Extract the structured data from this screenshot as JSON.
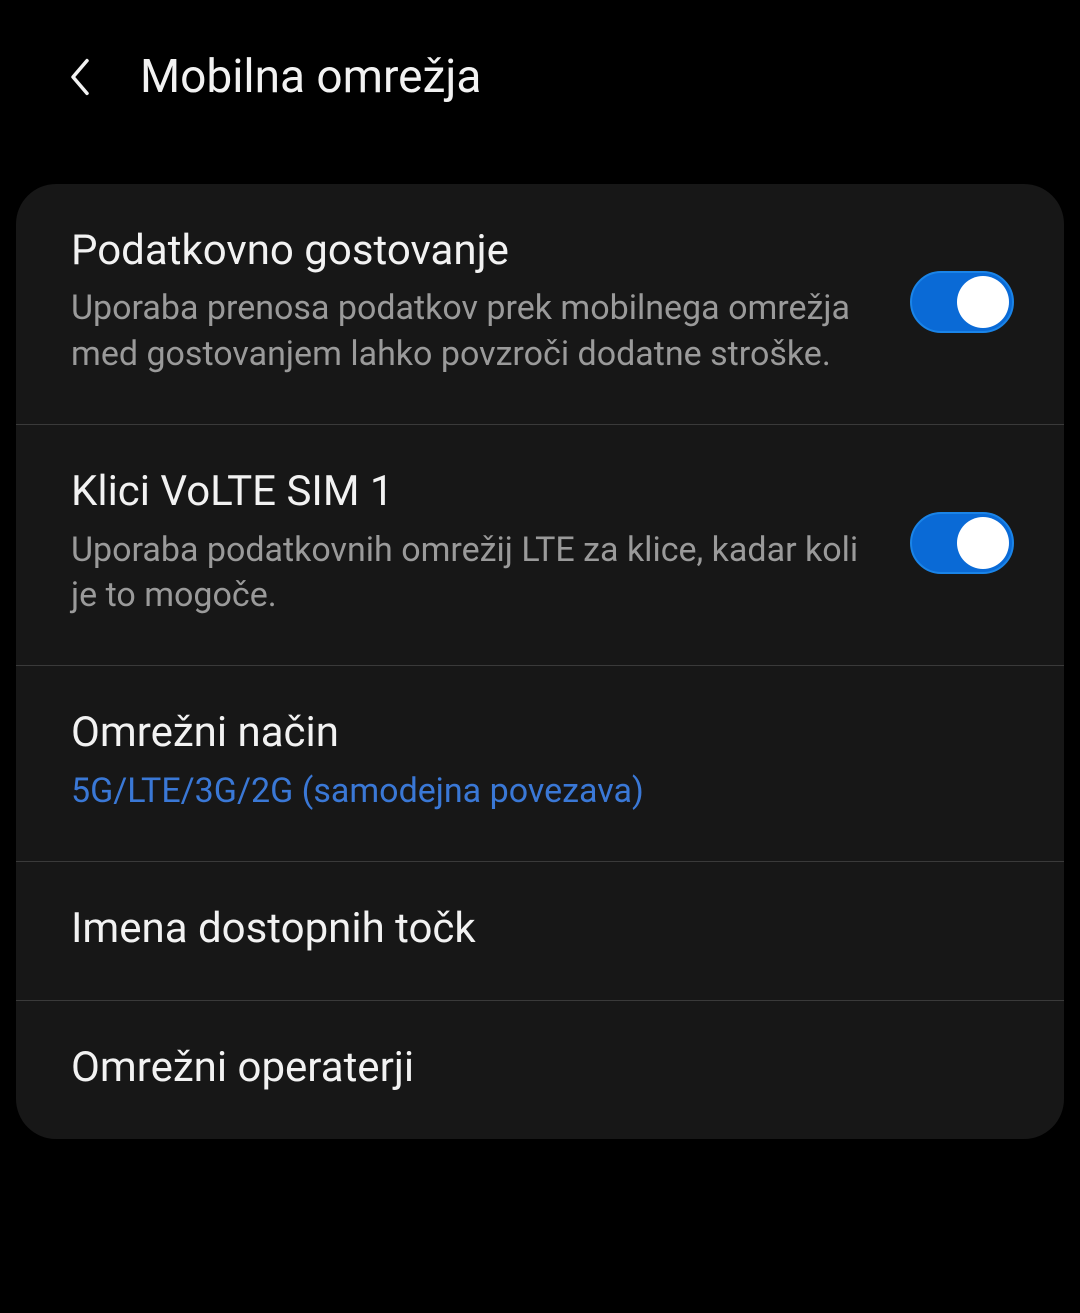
{
  "header": {
    "title": "Mobilna omrežja"
  },
  "settings": {
    "data_roaming": {
      "title": "Podatkovno gostovanje",
      "subtitle": "Uporaba prenosa podatkov prek mobilnega omrežja med gostovanjem lahko povzroči dodatne stroške.",
      "enabled": true
    },
    "volte": {
      "title": "Klici VoLTE SIM 1",
      "subtitle": "Uporaba podatkovnih omrežij LTE za klice, kadar koli je to mogoče.",
      "enabled": true
    },
    "network_mode": {
      "title": "Omrežni način",
      "value": "5G/LTE/3G/2G (samodejna povezava)"
    },
    "apn": {
      "title": "Imena dostopnih točk"
    },
    "operators": {
      "title": "Omrežni operaterji"
    }
  },
  "colors": {
    "background": "#000000",
    "panel": "#171717",
    "text_primary": "#f2f2f2",
    "text_secondary": "#9a9a9a",
    "accent": "#3a78d6",
    "toggle_on": "#0a6ad6",
    "divider": "#3a3a3a"
  }
}
